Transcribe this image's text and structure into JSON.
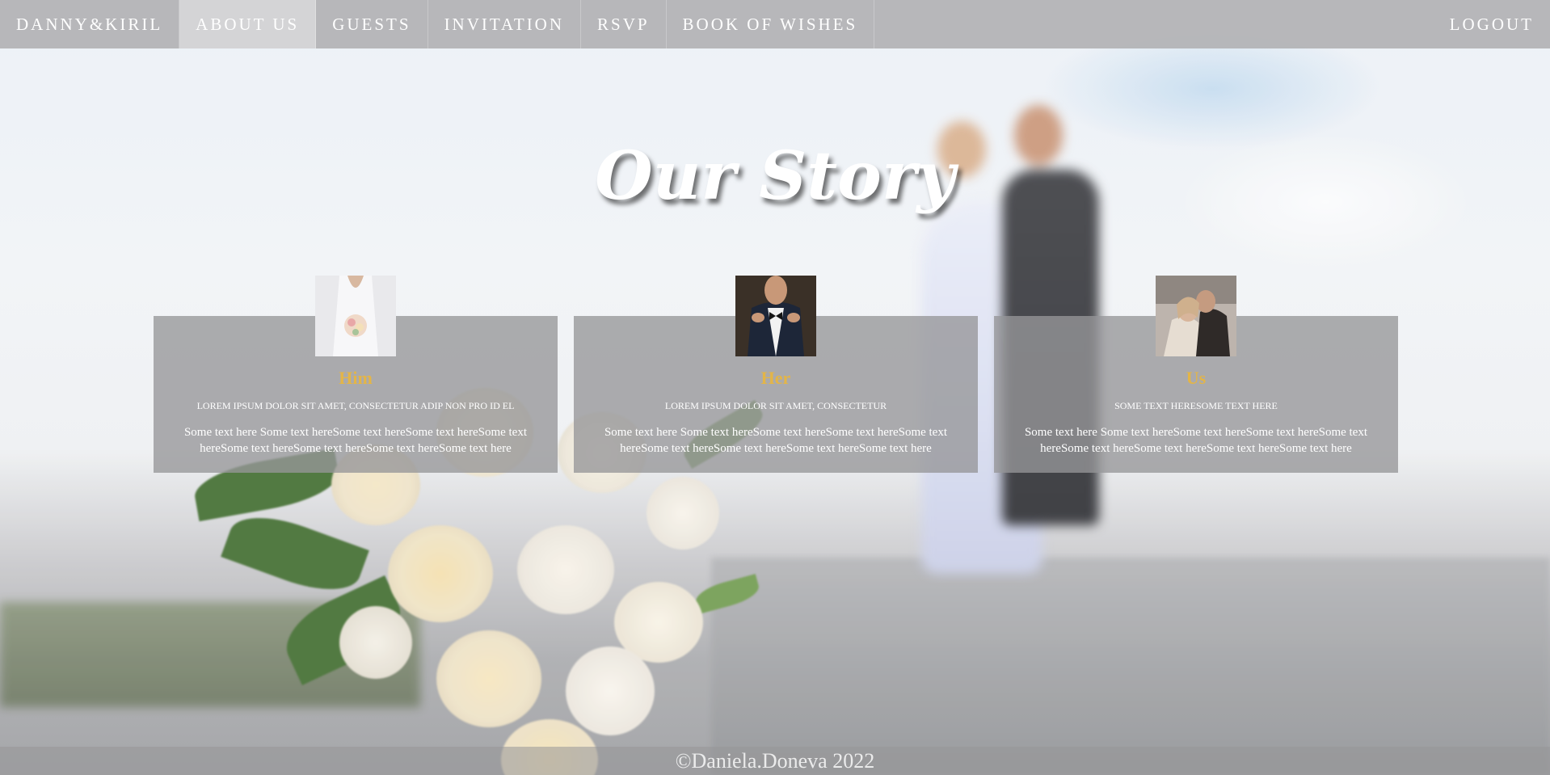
{
  "nav": {
    "brand": "DANNY&KIRIL",
    "items": [
      {
        "label": "ABOUT US",
        "active": true
      },
      {
        "label": "GUESTS",
        "active": false
      },
      {
        "label": "INVITATION",
        "active": false
      },
      {
        "label": "RSVP",
        "active": false
      },
      {
        "label": "BOOK OF WISHES",
        "active": false
      }
    ],
    "logout": "LOGOUT"
  },
  "main": {
    "title": "Our Story",
    "cards": [
      {
        "name": "Him",
        "subtitle": "LOREM IPSUM DOLOR SIT AMET, CONSECTETUR ADIP NON PRO ID EL",
        "body": "Some text here Some text hereSome text hereSome text hereSome text hereSome text hereSome text hereSome text hereSome text here",
        "photo_icon": "bride-bouquet-photo"
      },
      {
        "name": "Her",
        "subtitle": "LOREM IPSUM DOLOR SIT AMET, CONSECTETUR",
        "body": "Some text here Some text hereSome text hereSome text hereSome text hereSome text hereSome text hereSome text hereSome text here",
        "photo_icon": "groom-bowtie-photo"
      },
      {
        "name": "Us",
        "subtitle": "SOME TEXT HERESOME TEXT HERE",
        "body": "Some text here Some text hereSome text hereSome text hereSome text hereSome text hereSome text hereSome text hereSome text here",
        "photo_icon": "couple-kiss-photo"
      }
    ]
  },
  "footer": {
    "copyright": "©Daniela.Doneva 2022"
  },
  "colors": {
    "accent_name": "#e3b548",
    "navbar": "#b2b2b4",
    "card_bg": "#969698"
  }
}
